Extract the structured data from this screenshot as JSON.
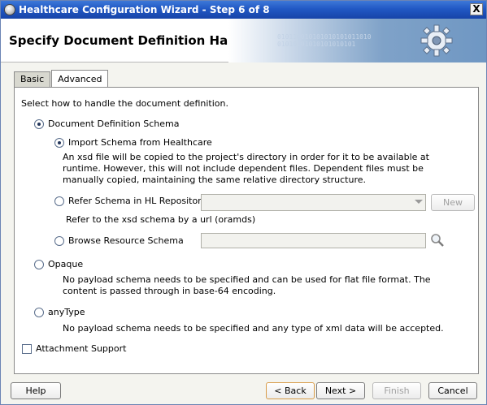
{
  "window": {
    "title": "Healthcare Configuration Wizard - Step 6 of 8",
    "close_label": "X"
  },
  "header": {
    "title": "Specify Document Definition Handling",
    "banner_text": "010110010101010101011010\n01010101010101010101"
  },
  "tabs": [
    {
      "label": "Basic",
      "active": false
    },
    {
      "label": "Advanced",
      "active": true
    }
  ],
  "panel": {
    "instruction": "Select how to handle the document definition.",
    "document_definition_schema": {
      "label": "Document Definition Schema",
      "selected": true
    },
    "import_schema": {
      "label": "Import Schema from Healthcare",
      "selected": true,
      "description": "An xsd file will be copied to the project's directory in order for it to be available at runtime.  However, this will not include dependent files.  Dependent files must be manually copied, maintaining the same relative directory structure."
    },
    "refer_schema": {
      "label": "Refer Schema in HL Repository",
      "selected": false,
      "combo_value": "",
      "new_button": "New",
      "description": "Refer to the xsd schema by a url (oramds)"
    },
    "browse_schema": {
      "label": "Browse Resource Schema",
      "selected": false,
      "field_value": ""
    },
    "opaque": {
      "label": "Opaque",
      "selected": false,
      "description": "No payload schema needs to be specified and can be used for flat file format. The content is passed through in base-64 encoding."
    },
    "anytype": {
      "label": "anyType",
      "selected": false,
      "description": "No payload schema needs to be specified and any type of xml data will be accepted."
    },
    "attachment_support": {
      "label": "Attachment Support",
      "checked": false
    }
  },
  "footer": {
    "help": "Help",
    "back": "< Back",
    "next": "Next >",
    "finish": "Finish",
    "cancel": "Cancel"
  }
}
